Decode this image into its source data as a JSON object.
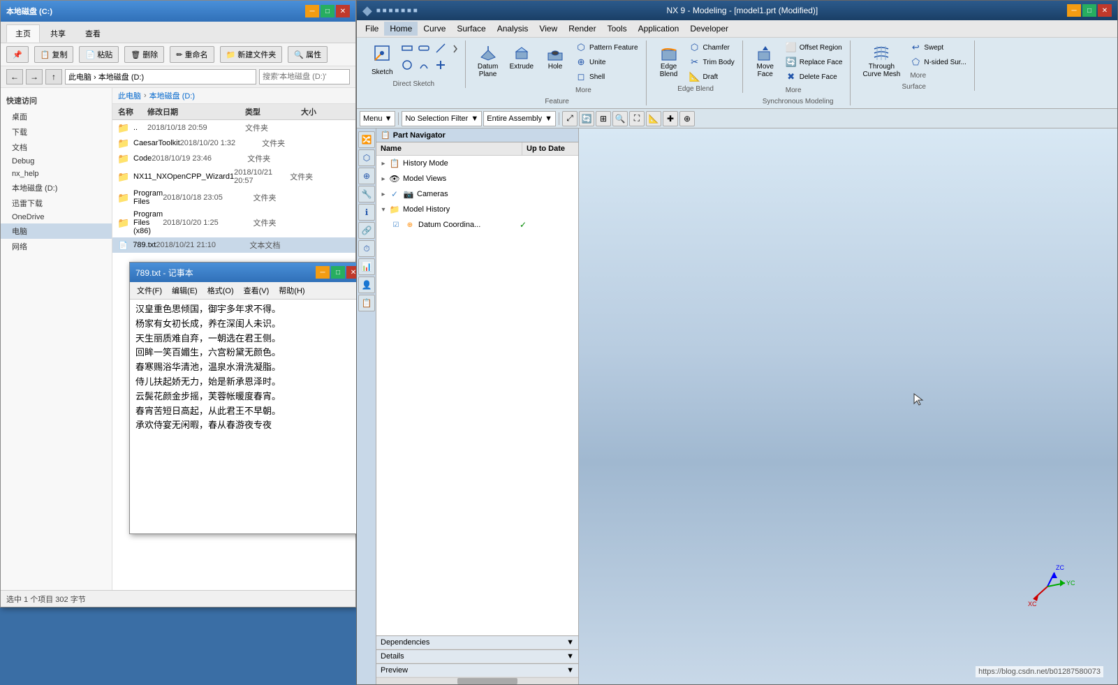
{
  "desktop": {
    "background": "#3a6ea5"
  },
  "explorer": {
    "title": "本地磁盘 (C:)",
    "titlebar_subtitle": "本地磁盘 (C:)",
    "tabs": [
      "主页",
      "共享",
      "查看"
    ],
    "nav_buttons": [
      "←",
      "→",
      "↑"
    ],
    "address": "此电脑 › 本地磁盘 (D:)",
    "search_placeholder": "搜索'本地磁盘 (D:)'",
    "path_segments": [
      "此电脑",
      "本地磁盘 (D:)"
    ],
    "quick_access_header": "快速访问",
    "quick_access_items": [
      "桌面",
      "下载",
      "文档",
      "Debug",
      "nx_help",
      "本地磁盘 (D:)",
      "迅雷下载",
      "OneDrive",
      "电脑",
      "网络"
    ],
    "columns": {
      "name": "名称",
      "date": "修改日期",
      "type": "类型",
      "size": "大小"
    },
    "parent_folder_date": "2018/10/18 20:59",
    "parent_folder_type": "文件夹",
    "files": [
      {
        "name": "CaesarToolkit",
        "date": "2018/10/20 1:32",
        "type": "文件夹",
        "size": ""
      },
      {
        "name": "Code",
        "date": "2018/10/19 23:46",
        "type": "文件夹",
        "size": ""
      },
      {
        "name": "NX11_NXOpenCPP_Wizard1",
        "date": "2018/10/21 20:57",
        "type": "文件夹",
        "size": ""
      },
      {
        "name": "Program Files",
        "date": "2018/10/18 23:05",
        "type": "文件夹",
        "size": ""
      },
      {
        "name": "Program Files (x86)",
        "date": "2018/10/20 1:25",
        "type": "文件夹",
        "size": ""
      },
      {
        "name": "789.txt",
        "date": "2018/10/21 21:10",
        "type": "文本文档",
        "size": ""
      }
    ],
    "status": "选中 1 个项目 302 字节"
  },
  "notepad": {
    "title": "789.txt - 记事本",
    "menu_items": [
      "文件(F)",
      "编辑(E)",
      "格式(O)",
      "查看(V)",
      "帮助(H)"
    ],
    "content": "汉皇重色思倾国，御宇多年求不得。\n杨家有女初长成，养在深闺人未识。\n天生丽质难自弃，一朝选在君王侧。\n回眸一笑百媚生，六宫粉黛无颜色。\n春寒赐浴华清池，温泉水滑洗凝脂。\n侍儿扶起娇无力，始是新承恩泽时。\n云鬓花颜金步摇，芙蓉帐暖度春宵。\n春宵苦短日高起，从此君王不早朝。\n承欢侍宴无闲暇，春从春游夜专夜"
  },
  "nx": {
    "title": "NX 9 - Modeling - [model1.prt (Modified)]",
    "menu_items": [
      "File",
      "Home",
      "Curve",
      "Surface",
      "Analysis",
      "View",
      "Render",
      "Tools",
      "Application",
      "Developer"
    ],
    "active_menu": "Home",
    "ribbon_tabs": [
      "Home",
      "Curve",
      "Surface",
      "Analysis",
      "View",
      "Render",
      "Tools",
      "Application",
      "Developer"
    ],
    "active_tab": "Home",
    "ribbon_groups": {
      "direct_sketch": {
        "label": "Direct Sketch",
        "big_btn": {
          "icon": "✏",
          "label": "Sketch"
        }
      },
      "feature": {
        "label": "Feature",
        "buttons": [
          {
            "icon": "⬛",
            "label": "Datum Plane"
          },
          {
            "icon": "⬜",
            "label": "Extrude"
          },
          {
            "icon": "○",
            "label": "Hole"
          }
        ],
        "small_btns": [
          {
            "icon": "🔷",
            "label": "Pattern Feature"
          },
          {
            "icon": "🔗",
            "label": "Unite"
          },
          {
            "icon": "🔶",
            "label": "Shell"
          }
        ],
        "more": "More"
      },
      "edge_blend": {
        "label": "Edge Blend",
        "small_btns": [
          {
            "icon": "⬡",
            "label": "Chamfer"
          },
          {
            "icon": "✂",
            "label": "Trim Body"
          },
          {
            "icon": "📐",
            "label": "Draft"
          }
        ]
      },
      "synchronous": {
        "label": "Synchronous Modeling",
        "buttons": [
          {
            "label": "Offset Region"
          },
          {
            "label": "Replace Face"
          },
          {
            "label": "Delete Face"
          }
        ],
        "big_btns": [
          {
            "label": "Move Face"
          },
          {
            "label": "More"
          }
        ]
      },
      "surface": {
        "label": "Surface",
        "buttons": [
          {
            "label": "Through Curve Mesh"
          },
          {
            "label": "Swept"
          },
          {
            "label": "N-sided Sur..."
          }
        ],
        "more": "More"
      }
    },
    "toolbar": {
      "menu_btn": "Menu ▼",
      "filter_label": "No Selection Filter",
      "assembly_label": "Entire Assembly"
    },
    "part_navigator": {
      "title": "Part Navigator",
      "columns": {
        "name": "Name",
        "status": "Up to Date"
      },
      "items": [
        {
          "indent": 0,
          "expand": "▸",
          "icon": "📋",
          "label": "History Mode",
          "status": ""
        },
        {
          "indent": 0,
          "expand": "▸",
          "icon": "👁",
          "label": "Model Views",
          "status": ""
        },
        {
          "indent": 0,
          "expand": "▸",
          "icon": "📷",
          "label": "Cameras",
          "status": ""
        },
        {
          "indent": 0,
          "expand": "▾",
          "icon": "📁",
          "label": "Model History",
          "status": ""
        },
        {
          "indent": 1,
          "expand": "",
          "icon": "📐",
          "label": "Datum Coordina...",
          "status": "✓"
        }
      ]
    },
    "panel_sections": [
      {
        "label": "Dependencies"
      },
      {
        "label": "Details"
      },
      {
        "label": "Preview"
      }
    ],
    "status_url": "https://blog.csdn.net/b01287580073"
  }
}
